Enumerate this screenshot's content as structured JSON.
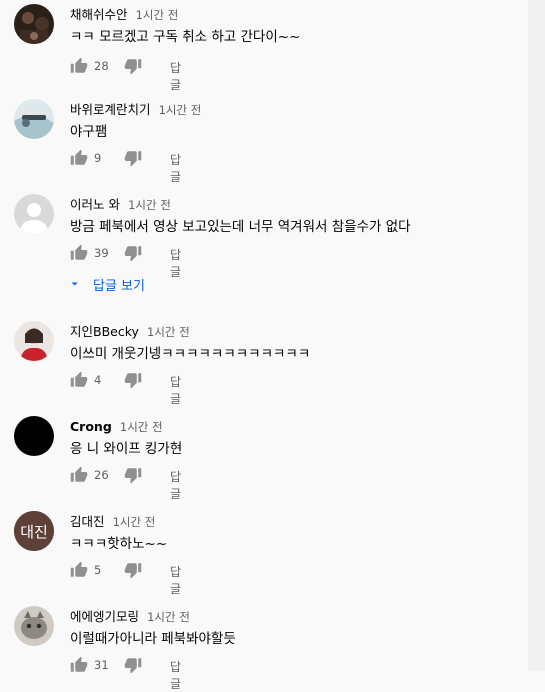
{
  "comments": [
    {
      "author": "채해쉬수안",
      "time": "1시간 전",
      "text": "ㅋㅋ 모르겠고 구독 취소 하고 간다이~~",
      "likes": "28",
      "reply": "답글",
      "avatar": "photo-avatar-dark"
    },
    {
      "author": "바위로계란치기",
      "time": "1시간 전",
      "text": "야구팸",
      "likes": "9",
      "reply": "답글",
      "avatar": "photo-avatar-light"
    },
    {
      "author": "이러노 와",
      "time": "1시간 전",
      "text": "방금 페북에서 영상 보고있는데 너무 역겨워서 참을수가 없다",
      "likes": "39",
      "reply": "답글",
      "avatar": "default-person-avatar"
    },
    {
      "author": "지인BBecky",
      "time": "1시간 전",
      "text": "이쓰미 개웃기넹ㅋㅋㅋㅋㅋㅋㅋㅋㅋㅋㅋㅋ",
      "likes": "4",
      "reply": "답글",
      "avatar": "photo-avatar-portrait"
    },
    {
      "author": "Crong",
      "time": "1시간 전",
      "text": "응 니 와이프 킹가현",
      "likes": "26",
      "reply": "답글",
      "avatar": "black-circle-avatar"
    },
    {
      "author": "김대진",
      "time": "1시간 전",
      "text": "ㅋㅋㅋ핫하노~~",
      "likes": "5",
      "reply": "답글",
      "avatar": "initials-avatar",
      "initials": "대진",
      "avatar_color": "#5d4037"
    },
    {
      "author": "에에엥기모링",
      "time": "1시간 전",
      "text": "이럴때가아니라 페북봐야할듯",
      "likes": "31",
      "reply": "답글",
      "avatar": "photo-avatar-cat"
    }
  ],
  "view_replies_label": "답글 보기",
  "colors": {
    "link": "#065fd4",
    "meta": "#606060",
    "text": "#030303",
    "background": "#f9f9f9"
  }
}
